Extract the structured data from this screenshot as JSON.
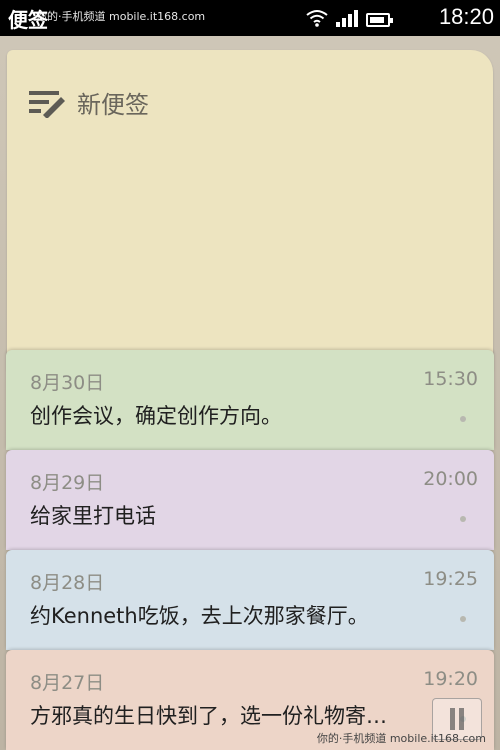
{
  "status_bar": {
    "app_title": "便签",
    "watermark": "你的·手机频道 mobile.it168.com",
    "time": "18:20"
  },
  "new_note": {
    "label": "新便签",
    "icon": "pen-lines-icon"
  },
  "notes": [
    {
      "date": "8月30日",
      "time": "15:30",
      "text": "创作会议，确定创作方向。",
      "color": "#d3e1c4"
    },
    {
      "date": "8月29日",
      "time": "20:00",
      "text": "给家里打电话",
      "color": "#e2d6e6"
    },
    {
      "date": "8月28日",
      "time": "19:25",
      "text": "约Kenneth吃饭，去上次那家餐厅。",
      "color": "#d5e1e9"
    },
    {
      "date": "8月27日",
      "time": "19:20",
      "text": "方邪真的生日快到了，选一份礼物寄…",
      "color": "#edd5c8"
    }
  ],
  "bottom_watermark": "你的·手机频道 mobile.it168.com"
}
